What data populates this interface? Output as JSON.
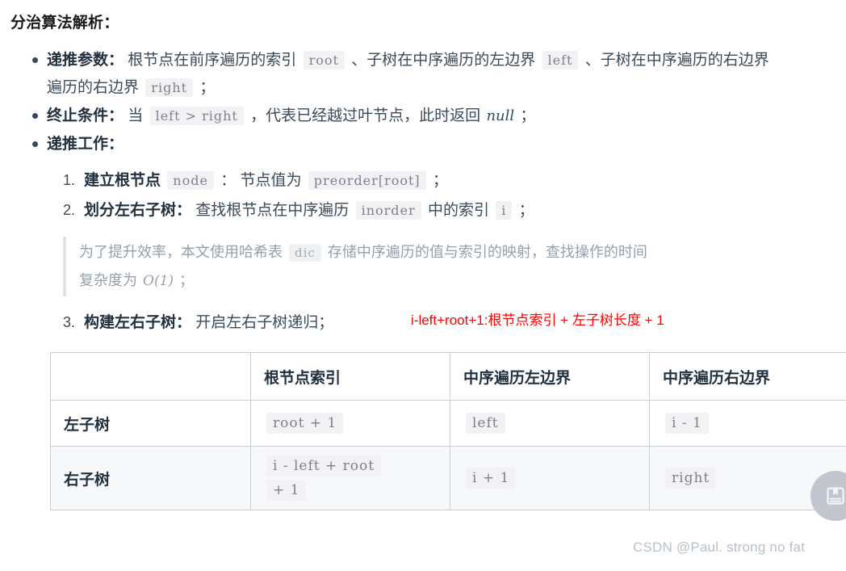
{
  "heading": "分治算法解析：",
  "bullets": [
    {
      "label": "递推参数：",
      "parts": [
        {
          "t": "text",
          "v": "根节点在前序遍历的索引 "
        },
        {
          "t": "code",
          "v": "root"
        },
        {
          "t": "text",
          "v": " 、子树在中序遍历的左边界 "
        },
        {
          "t": "code",
          "v": "left"
        },
        {
          "t": "text",
          "v": " 、子树在中序遍历的右边界 "
        },
        {
          "t": "code",
          "v": "right"
        },
        {
          "t": "text",
          "v": " ；"
        }
      ]
    },
    {
      "label": "终止条件：",
      "parts": [
        {
          "t": "text",
          "v": "当 "
        },
        {
          "t": "code",
          "v": "left > right"
        },
        {
          "t": "text",
          "v": " ，代表已经越过叶节点，此时返回 "
        },
        {
          "t": "math",
          "v": "null"
        },
        {
          "t": "text",
          "v": " ；"
        }
      ]
    },
    {
      "label": "递推工作：",
      "parts": []
    }
  ],
  "bullet1": {
    "label": "递推参数：",
    "seg_a": "根节点在前序遍历的索引",
    "code_root": "root",
    "seg_b": "、子树在中序遍历的左边界",
    "code_left": "left",
    "seg_c": "、子树在中序遍历的右边界",
    "seg_wrap": "遍历的右边界",
    "code_right": "right",
    "semi": "；"
  },
  "bullet2": {
    "label": "终止条件：",
    "seg_a": "当",
    "code_cond": "left > right",
    "seg_b": "，代表已经越过叶节点，此时返回",
    "math_null": "null",
    "semi": "；"
  },
  "bullet3": {
    "label": "递推工作："
  },
  "steps": [
    {
      "num": "1.",
      "label": "建立根节点",
      "code_a": "node",
      "mid": "： 节点值为",
      "code_b": "preorder[root]",
      "semi": "；"
    },
    {
      "num": "2.",
      "label": "划分左右子树：",
      "mid": "查找根节点在中序遍历",
      "code_a": "inorder",
      "mid2": "中的索引",
      "code_b": "i",
      "semi": "；"
    },
    {
      "num": "3.",
      "label": "构建左右子树：",
      "mid": "开启左右子树递归；"
    }
  ],
  "note": {
    "seg_a": "为了提升效率，本文使用哈希表",
    "code": "dic",
    "seg_b": "存储中序遍历的值与索引的映射，查找操作的时间",
    "seg_c": "复杂度为",
    "math": "O(1)",
    "semi": "；"
  },
  "annotation": {
    "text": "i-left+root+1:根节点索引 + 左子树长度 + 1",
    "color": "#fe0000"
  },
  "table": {
    "headers": [
      "",
      "根节点索引",
      "中序遍历左边界",
      "中序遍历右边界"
    ],
    "rows": [
      {
        "name": "左子树",
        "root_index": "root + 1",
        "inorder_left": "left",
        "inorder_right": "i - 1"
      },
      {
        "name": "右子树",
        "root_index_line1": "i - left + root",
        "root_index_line2": "+ 1",
        "inorder_left": "i + 1",
        "inorder_right": "right"
      }
    ]
  },
  "watermark": "CSDN @Paul. strong no fat",
  "fab": {
    "icon": "book-bookmark-icon"
  },
  "colors": {
    "text": "#34495e",
    "heading": "#1a1a1a",
    "code_bg": "#f2f2f5",
    "code_fg": "#7c828d",
    "note_fg": "#96a0ab",
    "table_border": "#c9cfd6",
    "row_alt_bg": "#f6f8fa",
    "accent_red": "#fe0000",
    "watermark": "#b9c0c8",
    "fab_bg": "#c2c7cf"
  }
}
